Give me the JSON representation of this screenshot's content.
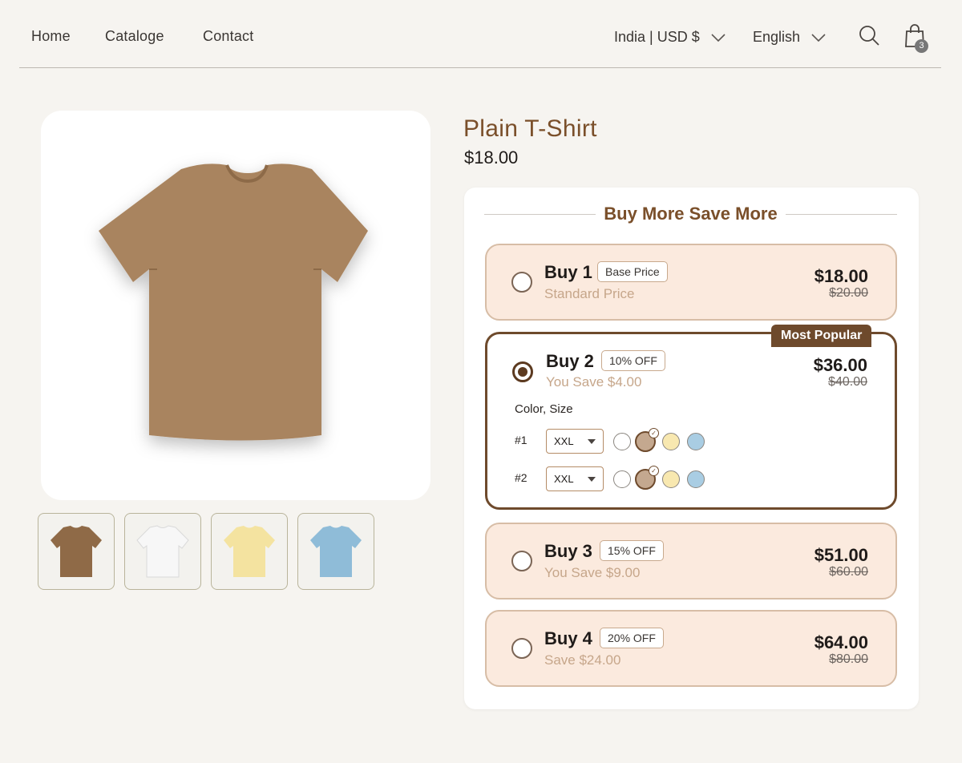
{
  "nav": {
    "links": [
      "Home",
      "Cataloge",
      "Contact"
    ],
    "region": "India | USD $",
    "language": "English",
    "cart_count": "3"
  },
  "gallery": {
    "main_color": "#a9845f",
    "thumbs": [
      {
        "name": "brown",
        "color": "#8f6a47"
      },
      {
        "name": "white",
        "color": "#f1f1f1"
      },
      {
        "name": "yellow",
        "color": "#f4e3a0"
      },
      {
        "name": "blue",
        "color": "#8fbcd8"
      }
    ]
  },
  "product": {
    "title": "Plain T-Shirt",
    "price": "$18.00"
  },
  "bundle": {
    "heading": "Buy More Save More",
    "popular_label": "Most Popular",
    "options": [
      {
        "qty": "Buy 1",
        "tag": "Base Price",
        "sub": "Standard Price",
        "price": "$18.00",
        "was": "$20.00",
        "selected": false
      },
      {
        "qty": "Buy 2",
        "tag": "10% OFF",
        "sub": "You Save $4.00",
        "price": "$36.00",
        "was": "$40.00",
        "selected": true
      },
      {
        "qty": "Buy 3",
        "tag": "15% OFF",
        "sub": "You Save $9.00",
        "price": "$51.00",
        "was": "$60.00",
        "selected": false
      },
      {
        "qty": "Buy 4",
        "tag": "20% OFF",
        "sub": "Save $24.00",
        "price": "$64.00",
        "was": "$80.00",
        "selected": false
      }
    ],
    "variant_label": "Color, Size",
    "variants": [
      {
        "label": "#1",
        "size": "XXL",
        "selected_color": "tan"
      },
      {
        "label": "#2",
        "size": "XXL",
        "selected_color": "tan"
      }
    ],
    "swatches": [
      {
        "name": "white",
        "color": "#ffffff"
      },
      {
        "name": "tan",
        "color": "#c4a88f"
      },
      {
        "name": "yellow",
        "color": "#f8e8b0"
      },
      {
        "name": "blue",
        "color": "#a9cde3"
      }
    ]
  }
}
